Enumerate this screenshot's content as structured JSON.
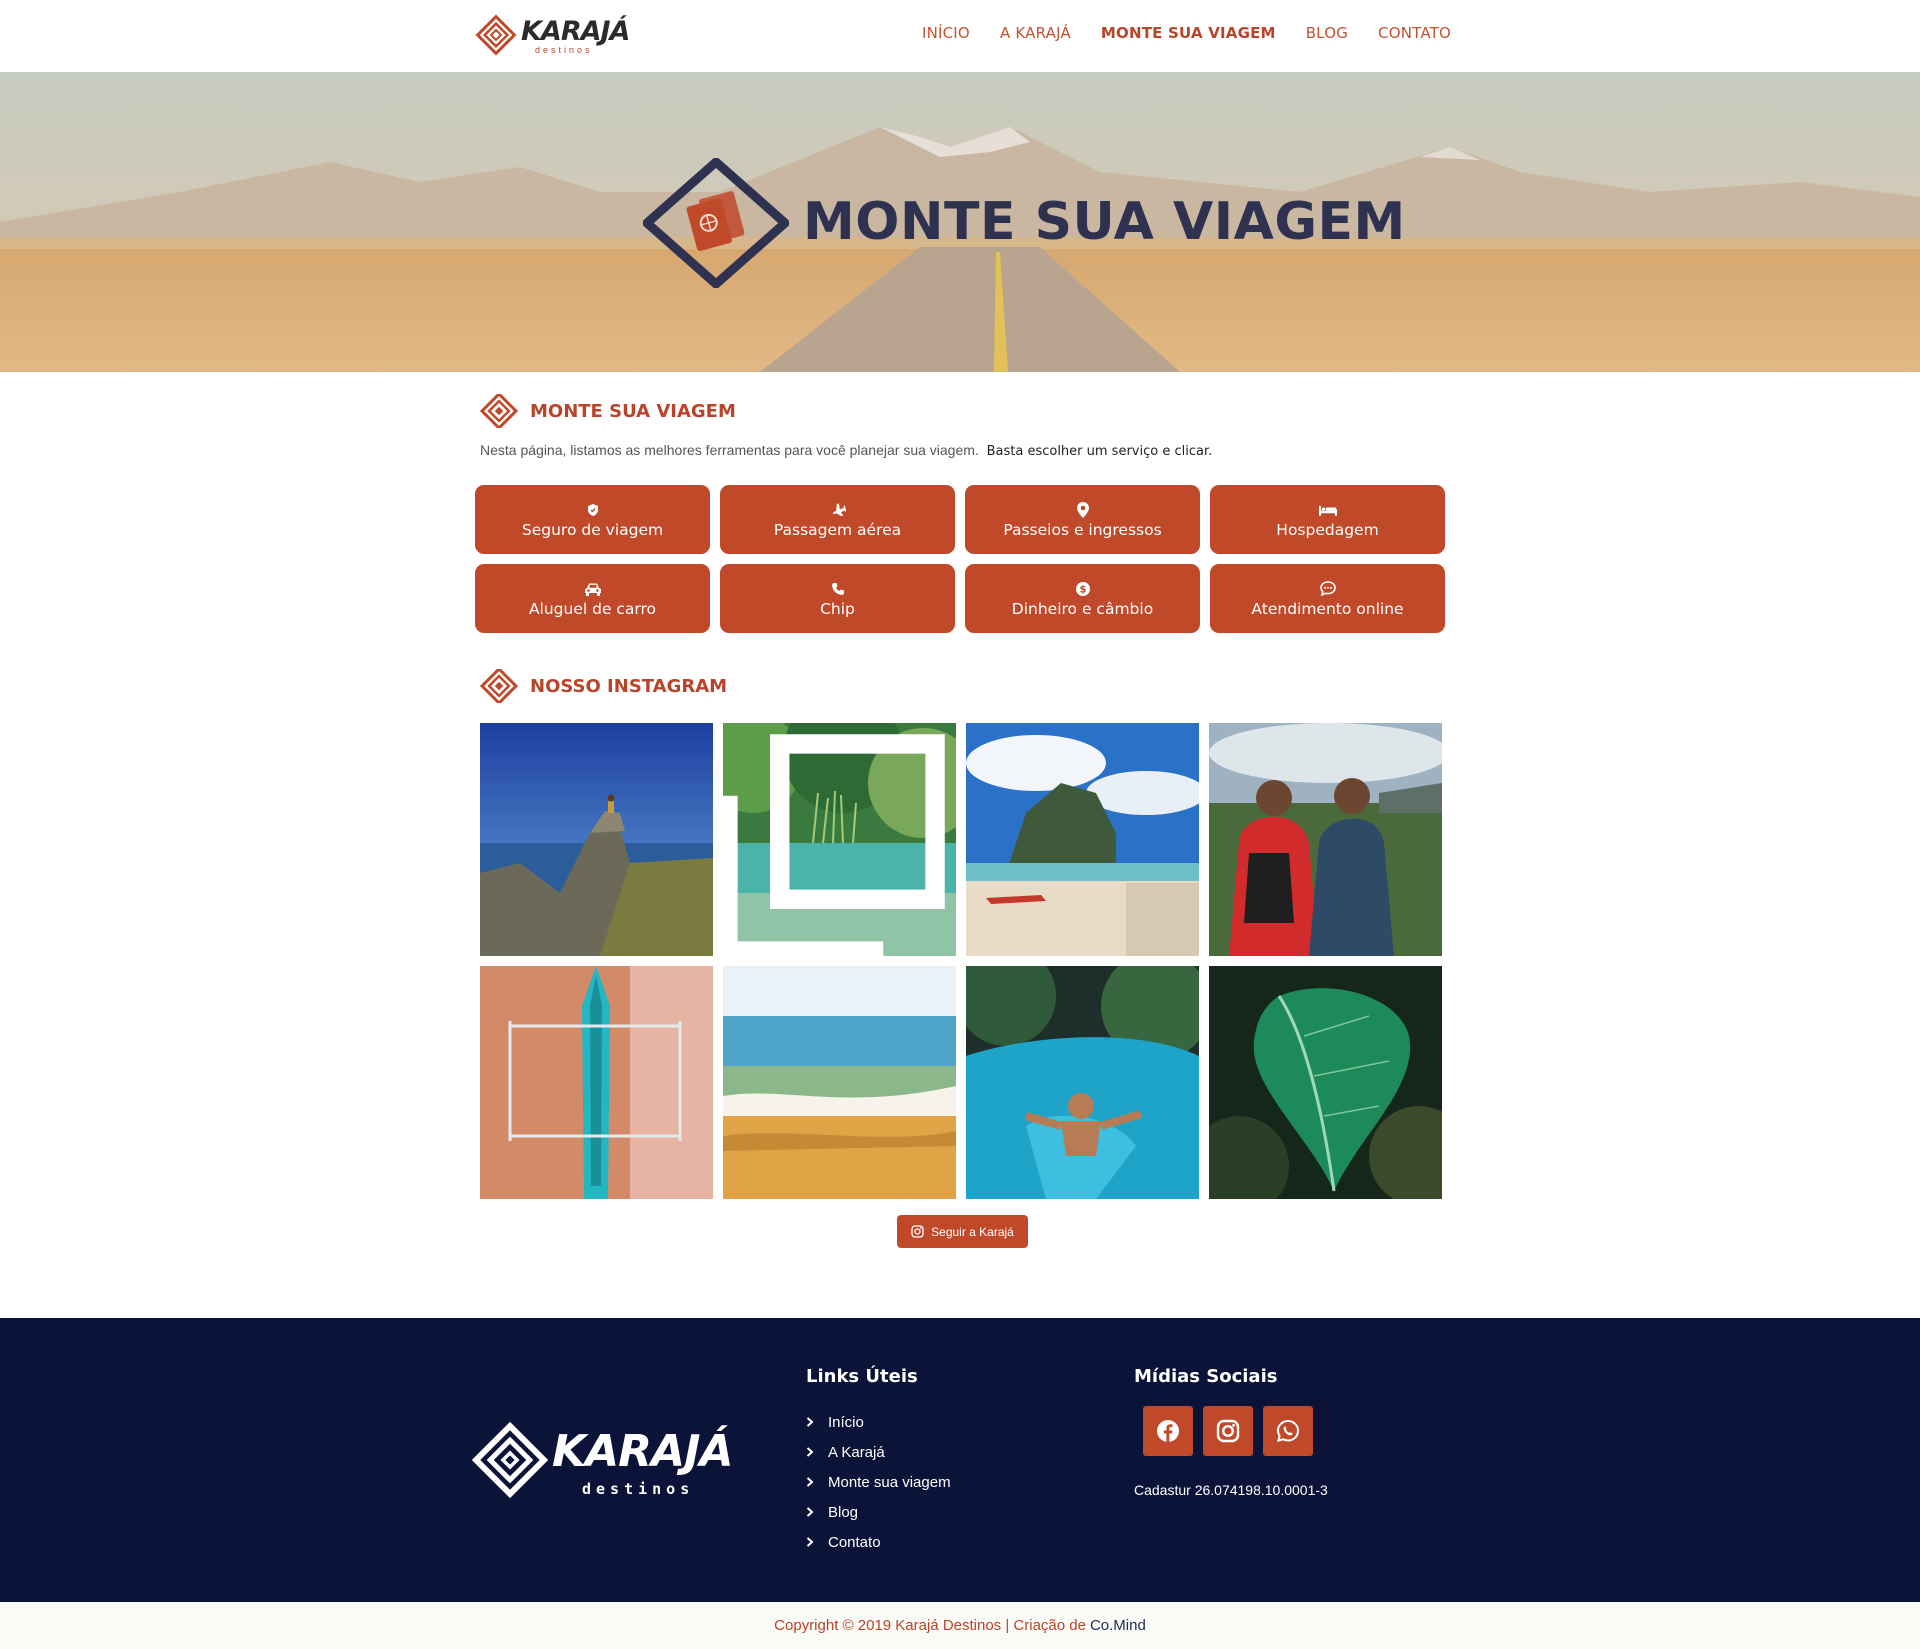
{
  "header": {
    "logo_text": "KARAJÁ",
    "logo_sub": "destinos",
    "nav": [
      {
        "label": "INÍCIO"
      },
      {
        "label": "A KARAJÁ"
      },
      {
        "label": "MONTE SUA VIAGEM"
      },
      {
        "label": "BLOG"
      },
      {
        "label": "CONTATO"
      }
    ],
    "active_nav": "MONTE SUA VIAGEM"
  },
  "hero": {
    "title": "MONTE SUA VIAGEM"
  },
  "main": {
    "section_title": "MONTE SUA VIAGEM",
    "intro_text": "Nesta página, listamos as melhores ferramentas para você planejar sua viagem.",
    "intro_bold": "Basta escolher um serviço e clicar.",
    "services": [
      {
        "label": "Seguro de viagem",
        "icon": "shield-icon"
      },
      {
        "label": "Passagem aérea",
        "icon": "plane-icon"
      },
      {
        "label": "Passeios e ingressos",
        "icon": "map-pin-icon"
      },
      {
        "label": "Hospedagem",
        "icon": "bed-icon"
      },
      {
        "label": "Aluguel de carro",
        "icon": "car-icon"
      },
      {
        "label": "Chip",
        "icon": "phone-icon"
      },
      {
        "label": "Dinheiro e câmbio",
        "icon": "dollar-icon"
      },
      {
        "label": "Atendimento online",
        "icon": "chat-icon"
      }
    ],
    "instagram_title": "NOSSO INSTAGRAM",
    "follow_label": "Seguir a Karajá"
  },
  "footer": {
    "logo_text": "KARAJÁ",
    "logo_sub": "destinos",
    "links_title": "Links Úteis",
    "links": [
      {
        "label": "Início"
      },
      {
        "label": "A Karajá"
      },
      {
        "label": "Monte sua viagem"
      },
      {
        "label": "Blog"
      },
      {
        "label": "Contato"
      }
    ],
    "social_title": "Mídias Sociais",
    "social_icons": [
      "facebook-icon",
      "instagram-icon",
      "whatsapp-icon"
    ],
    "cadastur": "Cadastur 26.074198.10.0001-3",
    "copyright": "Copyright © 2019 Karajá Destinos | Criação de",
    "copyright_link": "Co.Mind"
  },
  "colors": {
    "accent": "#c0492a",
    "navy": "#0b1438",
    "hero_title": "#2e3250"
  }
}
